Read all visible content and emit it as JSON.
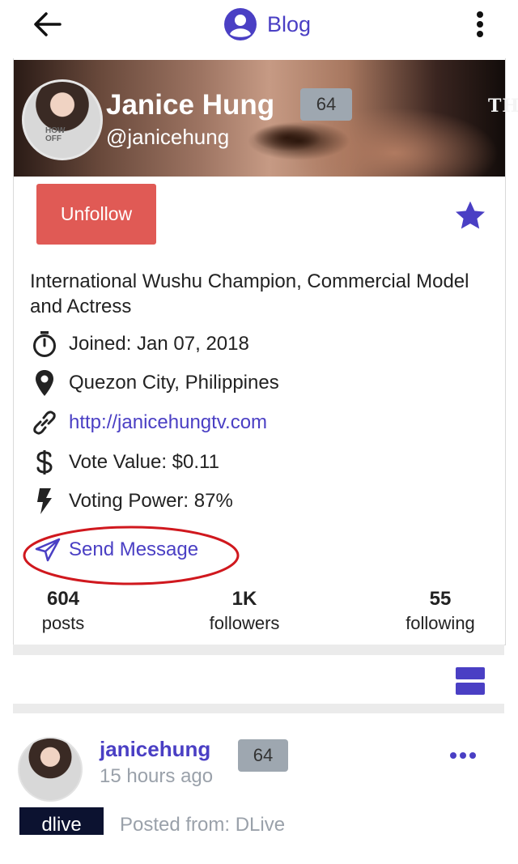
{
  "header": {
    "title": "Blog",
    "back_icon": "arrow-left-icon",
    "title_icon": "account-circle-icon",
    "menu_icon": "more-vertical-icon",
    "accent": "#4a3fc4"
  },
  "profile": {
    "banner_tag": "TH",
    "name": "Janice Hung",
    "handle": "@janicehung",
    "reputation": "64",
    "unfollow_label": "Unfollow",
    "bio": "International Wushu Champion, Commercial Model and Actress",
    "joined": "Joined: Jan 07, 2018",
    "location": "Quezon City, Philippines",
    "website": "http://janicehungtv.com",
    "vote_value": "Vote Value: $0.11",
    "voting_power": "Voting Power: 87%",
    "send_message": "Send Message",
    "colors": {
      "unfollow": "#e05a55",
      "badge": "#9ea7b0",
      "annotation": "#d0181e"
    }
  },
  "stats": [
    {
      "value": "604",
      "label": "posts"
    },
    {
      "value": "1K",
      "label": "followers"
    },
    {
      "value": "55",
      "label": "following"
    }
  ],
  "post": {
    "author": "janicehung",
    "time": "15 hours ago",
    "reputation": "64",
    "tag": "dlive",
    "posted_from": "Posted from: DLive"
  }
}
